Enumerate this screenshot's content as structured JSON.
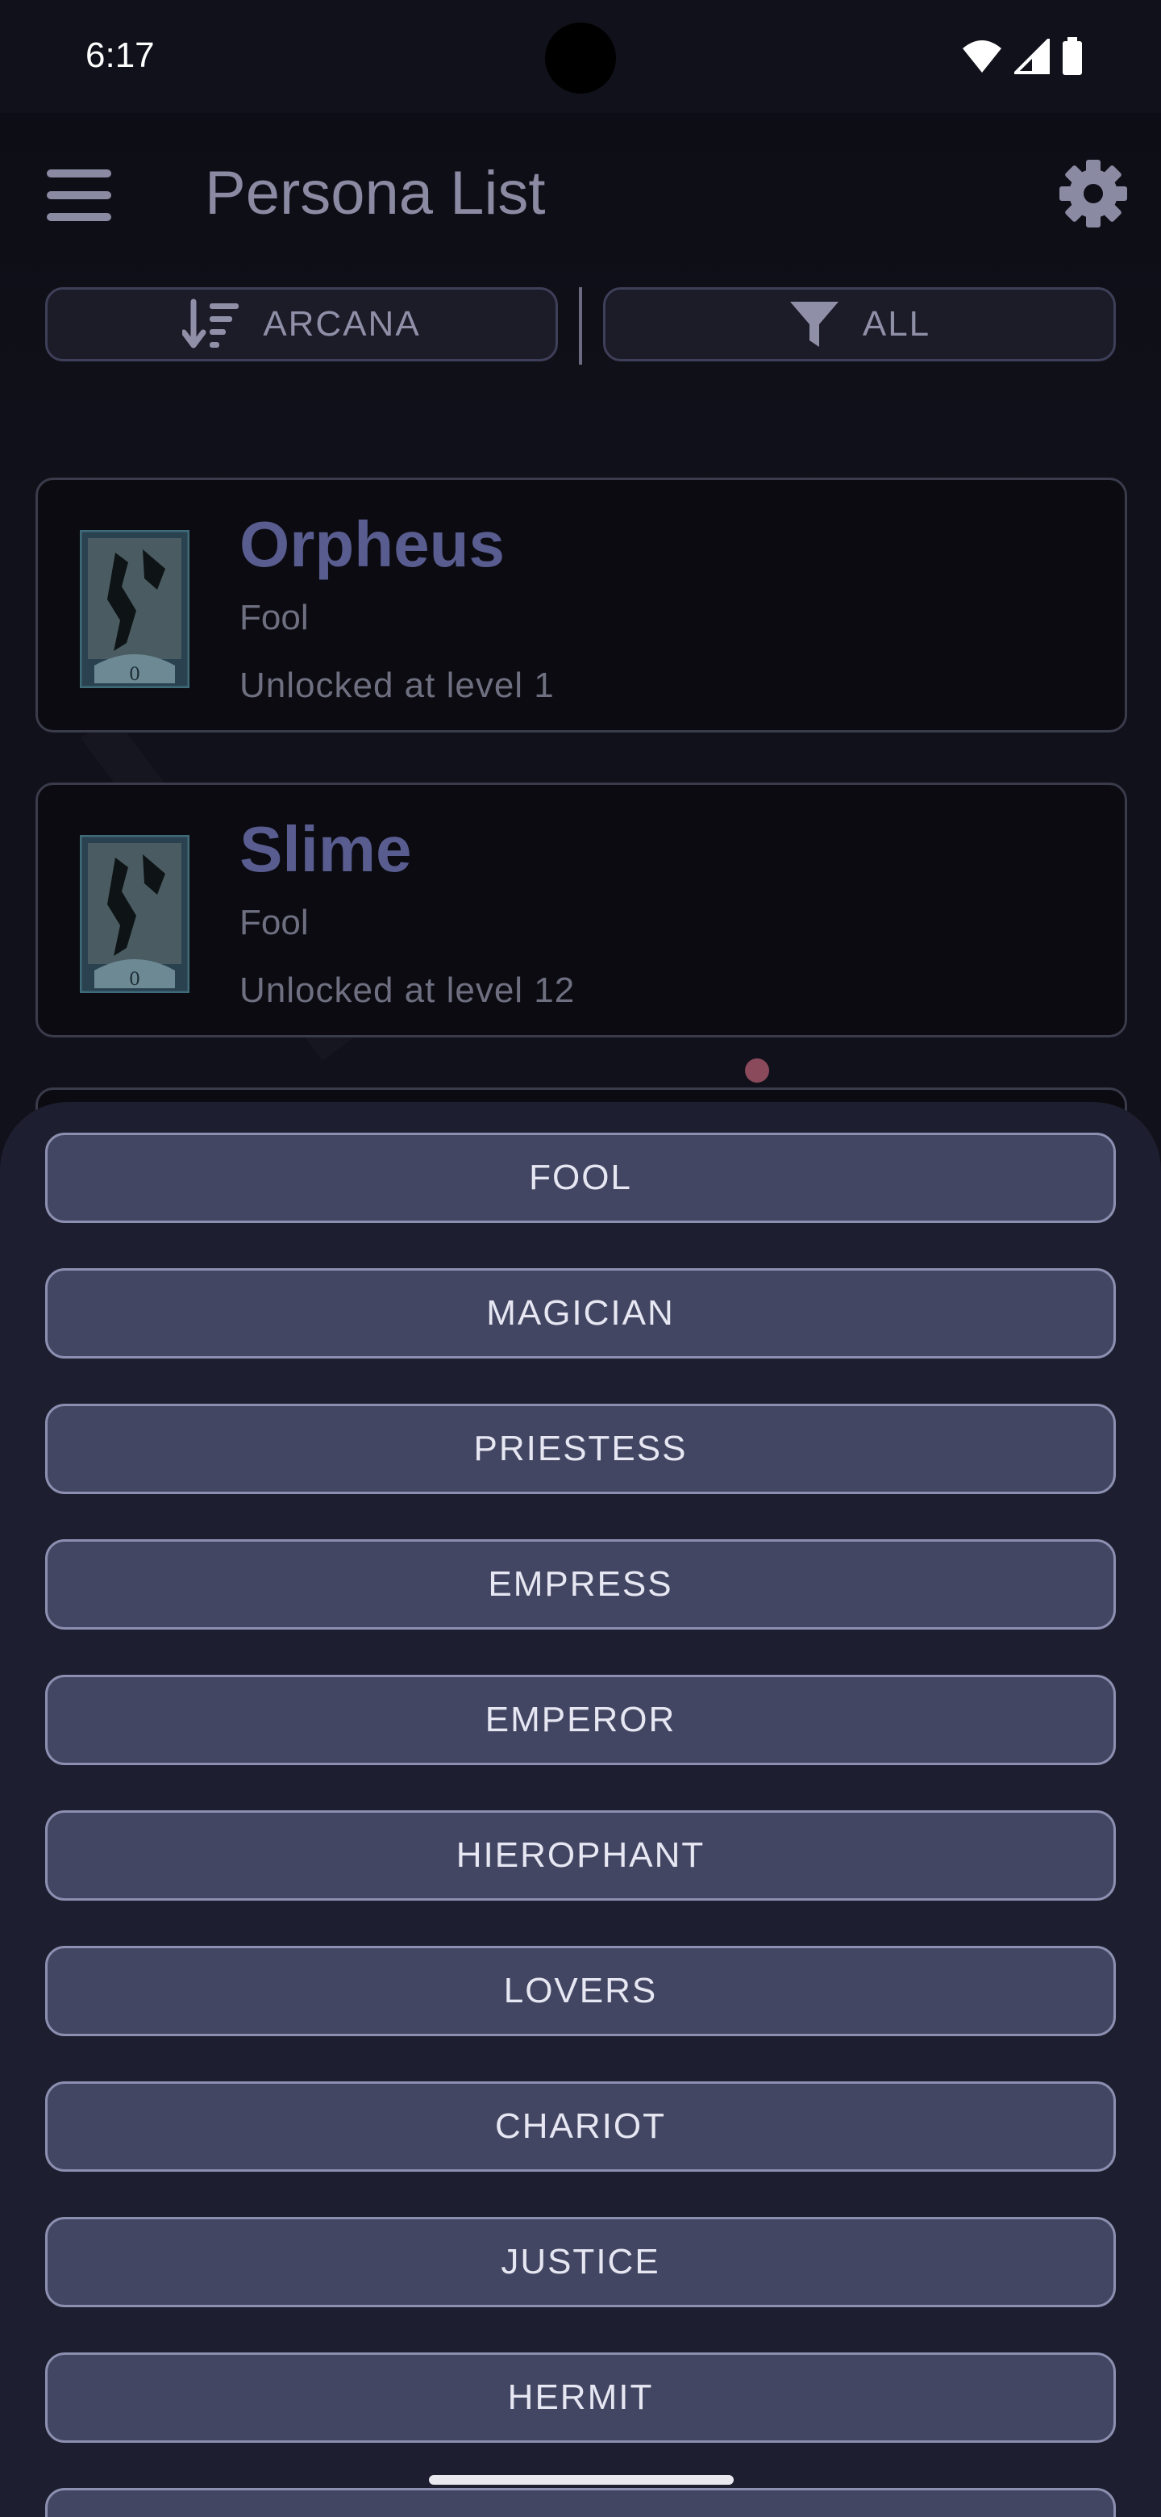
{
  "status_bar": {
    "time": "6:17",
    "icons": [
      "wifi-icon",
      "cellular-signal-icon",
      "battery-icon"
    ]
  },
  "app_bar": {
    "title": "Persona List",
    "menu_icon": "hamburger-menu-icon",
    "settings_icon": "gear-icon"
  },
  "toolbar": {
    "sort_label": "ARCANA",
    "sort_icon": "sort-descending-icon",
    "filter_label": "ALL",
    "filter_icon": "filter-funnel-icon"
  },
  "personas": [
    {
      "name": "Orpheus",
      "arcana": "Fool",
      "unlock": "Unlocked at level 1",
      "icon": "fool-tarot-card-icon"
    },
    {
      "name": "Slime",
      "arcana": "Fool",
      "unlock": "Unlocked at level 12",
      "icon": "fool-tarot-card-icon"
    }
  ],
  "card_numeral": "0",
  "arcana_options": [
    "FOOL",
    "MAGICIAN",
    "PRIESTESS",
    "EMPRESS",
    "EMPEROR",
    "HIEROPHANT",
    "LOVERS",
    "CHARIOT",
    "JUSTICE",
    "HERMIT"
  ],
  "colors": {
    "background": "#11111b",
    "sheet": "#1d1e2f",
    "option_fill": "#434662",
    "option_border": "#8c8fb0",
    "persona_name": "#585c8f",
    "notification_dot": "#8a4a5c"
  }
}
